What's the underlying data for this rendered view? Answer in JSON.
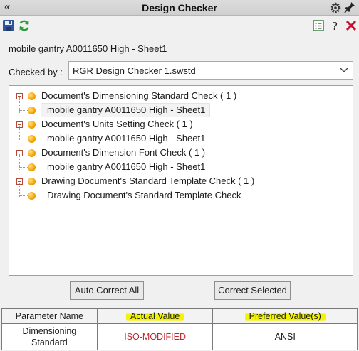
{
  "window": {
    "title": "Design Checker"
  },
  "toolbar": {
    "left_icons": [
      "save-icon",
      "refresh-icon"
    ],
    "right_icons": [
      "report-icon",
      "help-icon",
      "close-icon"
    ]
  },
  "document": {
    "title": "mobile gantry A0011650 High - Sheet1"
  },
  "checked_by": {
    "label": "Checked by :",
    "value": "RGR Design Checker 1.swstd"
  },
  "tree": {
    "items": [
      {
        "label": "Document's Dimensioning Standard Check ( 1 )",
        "child": "mobile gantry A0011650 High - Sheet1"
      },
      {
        "label": "Document's Units Setting Check ( 1 )",
        "child": "mobile gantry A0011650 High - Sheet1"
      },
      {
        "label": "Document's Dimension Font Check ( 1 )",
        "child": "mobile gantry A0011650 High - Sheet1"
      },
      {
        "label": "Drawing Document's Standard Template Check ( 1 )",
        "child": "Drawing Document's Standard Template Check"
      }
    ]
  },
  "buttons": {
    "auto_correct": "Auto Correct All",
    "correct_selected": "Correct Selected"
  },
  "table": {
    "headers": [
      "Parameter Name",
      "Actual Value",
      "Preferred Value(s)"
    ],
    "rows": [
      {
        "parameter_line1": "Dimensioning",
        "parameter_line2": "Standard",
        "actual": "ISO-MODIFIED",
        "preferred": "ANSI"
      }
    ]
  },
  "colors": {
    "actual_value_text": "#c0262d",
    "highlight": "#f6f500",
    "status_dot": "#f5a300"
  }
}
